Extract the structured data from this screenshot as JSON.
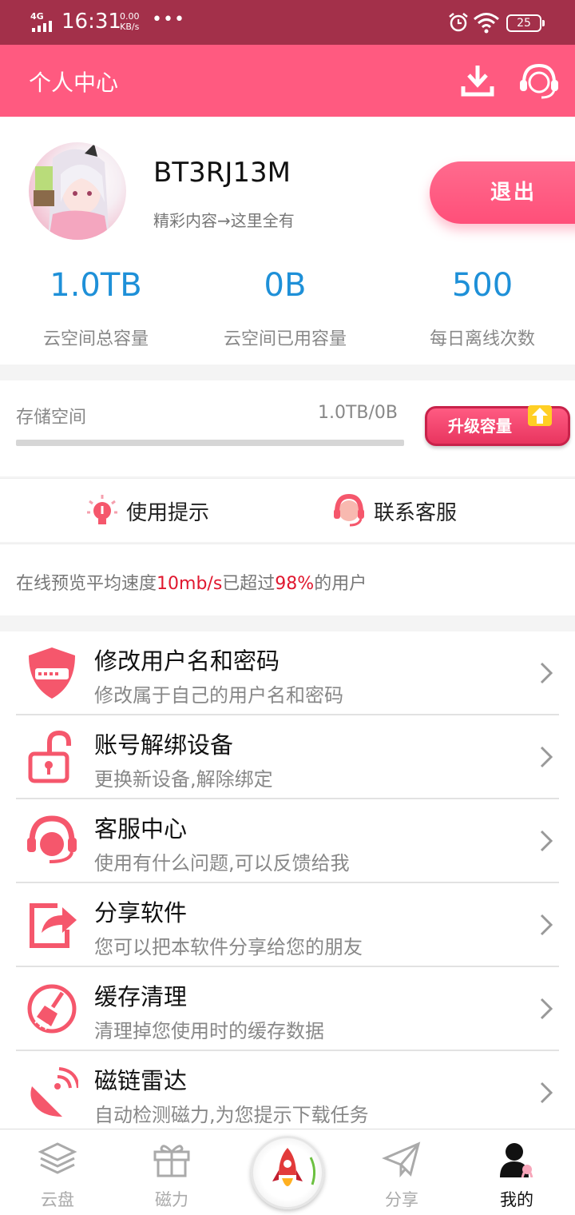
{
  "status_bar": {
    "network": "4G",
    "time": "16:31",
    "speed_value": "0.00",
    "speed_unit": "KB/s",
    "more": "•••",
    "battery": "25"
  },
  "header": {
    "title": "个人中心",
    "icons": [
      "download-icon",
      "customer-service-icon"
    ]
  },
  "profile": {
    "username": "BT3RJ13M",
    "slogan": "精彩内容→这里全有",
    "logout_label": "退出"
  },
  "stats": [
    {
      "value": "1.0TB",
      "label": "云空间总容量"
    },
    {
      "value": "0B",
      "label": "云空间已用容量"
    },
    {
      "value": "500",
      "label": "每日离线次数"
    }
  ],
  "storage": {
    "label": "存储空间",
    "value": "1.0TB/0B",
    "used_fraction": 0,
    "upgrade_label": "升级容量"
  },
  "quick_links": [
    {
      "label": "使用提示",
      "icon": "lightbulb-icon"
    },
    {
      "label": "联系客服",
      "icon": "headset-icon"
    }
  ],
  "speed_notice": {
    "prefix": "在线预览平均速度",
    "speed": "10mb/s",
    "middle": "已超过",
    "percent": "98%",
    "suffix": "的用户"
  },
  "menu": [
    {
      "title": "修改用户名和密码",
      "subtitle": "修改属于自己的用户名和密码",
      "icon": "shield-password-icon"
    },
    {
      "title": "账号解绑设备",
      "subtitle": "更换新设备,解除绑定",
      "icon": "unlock-icon"
    },
    {
      "title": "客服中心",
      "subtitle": "使用有什么问题,可以反馈给我",
      "icon": "headset-icon"
    },
    {
      "title": "分享软件",
      "subtitle": "您可以把本软件分享给您的朋友",
      "icon": "share-icon"
    },
    {
      "title": "缓存清理",
      "subtitle": "清理掉您使用时的缓存数据",
      "icon": "broom-icon"
    },
    {
      "title": "磁链雷达",
      "subtitle": "自动检测磁力,为您提示下载任务",
      "icon": "radar-icon"
    }
  ],
  "tabs": [
    {
      "label": "云盘",
      "icon": "layers-icon",
      "active": false
    },
    {
      "label": "磁力",
      "icon": "gift-icon",
      "active": false
    },
    {
      "label": "",
      "icon": "rocket-icon",
      "active": false
    },
    {
      "label": "分享",
      "icon": "paper-plane-icon",
      "active": false
    },
    {
      "label": "我的",
      "icon": "user-icon",
      "active": true
    }
  ],
  "colors": {
    "status_bar": "#a3304a",
    "brand_pink": "#ff5a80",
    "stat_blue": "#1e90d8",
    "highlight_red": "#e0182f"
  }
}
